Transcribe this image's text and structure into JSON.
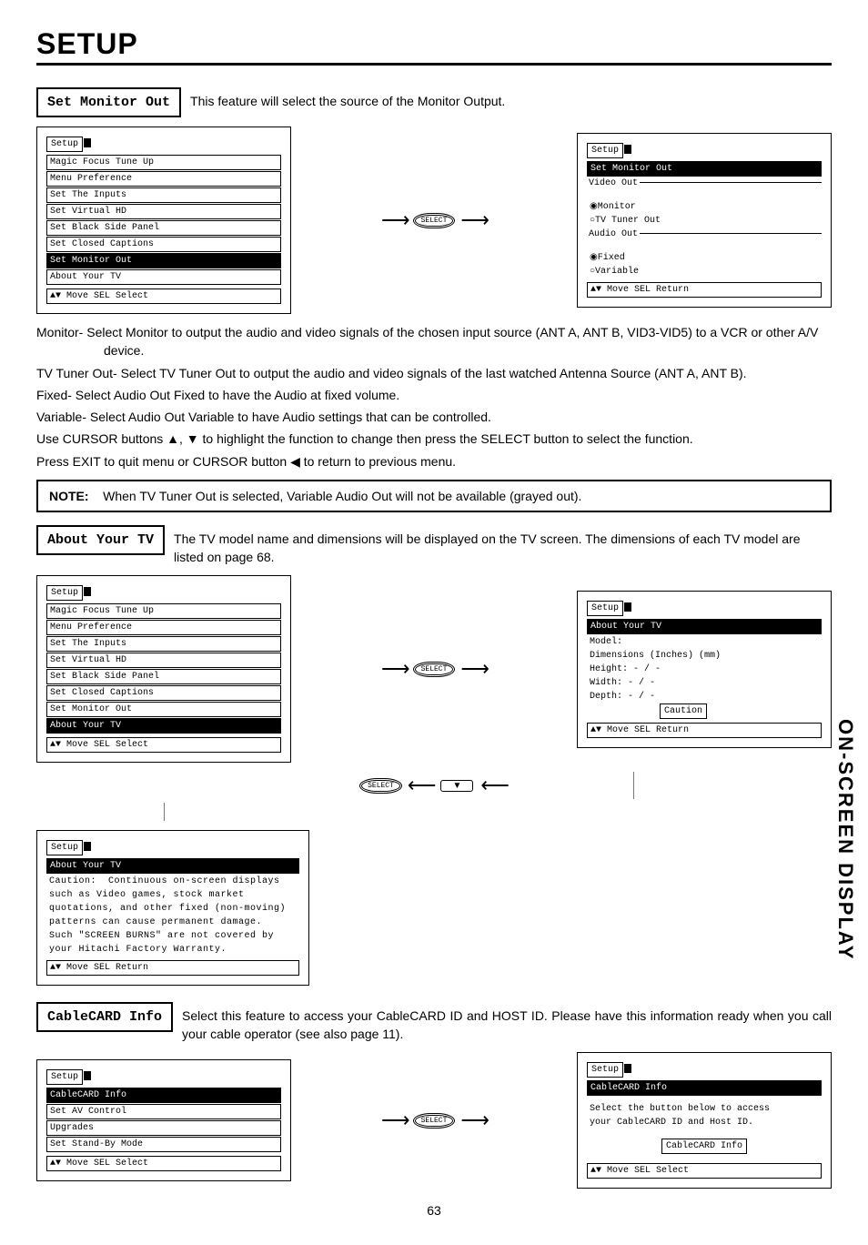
{
  "page": {
    "title": "Setup",
    "number": "63",
    "sidebar": "ON-SCREEN DISPLAY"
  },
  "setMonitorOut": {
    "label": "Set Monitor Out",
    "desc": "This feature will select the source of the Monitor Output.",
    "menuLeft": {
      "title": "Setup",
      "items": [
        "Magic Focus Tune Up",
        "Menu Preference",
        "Set The Inputs",
        "Set Virtual HD",
        "Set Black Side Panel",
        "Set Closed Captions",
        "Set Monitor Out",
        "About Your TV"
      ],
      "highlighted": "Set Monitor Out",
      "footer": "▲▼ Move  SEL Select"
    },
    "menuRight": {
      "title": "Setup",
      "header": "Set Monitor Out",
      "videoOut": {
        "label": "Video Out",
        "opts": [
          "Monitor",
          "TV Tuner Out"
        ],
        "sel": 0
      },
      "audioOut": {
        "label": "Audio Out",
        "opts": [
          "Fixed",
          "Variable"
        ],
        "sel": 0
      },
      "footer": "▲▼ Move  SEL Return"
    },
    "explain": {
      "monitor": "Monitor- Select Monitor to output the audio and video signals of the chosen input source (ANT A, ANT B, VID3-VID5) to a VCR or other A/V device.",
      "tuner": "TV Tuner Out- Select TV Tuner Out to output the audio and video signals of the last watched Antenna Source (ANT A, ANT B).",
      "fixed": "Fixed-  Select Audio Out Fixed to have the Audio at fixed volume.",
      "variable": "Variable- Select Audio Out Variable to have Audio settings that can be controlled.",
      "cursor": "Use CURSOR buttons ▲, ▼ to highlight the function to change then press the SELECT button to select the function.",
      "exit": "Press EXIT to quit menu or CURSOR button ◀ to return to previous menu."
    },
    "note": {
      "label": "NOTE:",
      "text": "When TV Tuner Out is selected, Variable Audio Out will not be available (grayed out)."
    }
  },
  "aboutYourTV": {
    "label": "About Your TV",
    "desc": "The TV model name and dimensions will be displayed on the TV screen.  The dimensions of each TV model are listed on page 68.",
    "menuLeft": {
      "title": "Setup",
      "items": [
        "Magic Focus Tune Up",
        "Menu Preference",
        "Set The Inputs",
        "Set Virtual HD",
        "Set Black Side Panel",
        "Set Closed Captions",
        "Set Monitor Out",
        "About Your TV"
      ],
      "highlighted": "About Your TV",
      "footer": "▲▼ Move  SEL Select"
    },
    "menuRight": {
      "title": "Setup",
      "header": "About Your TV",
      "model": "Model:",
      "dims": "Dimensions  (Inches) (mm)",
      "h": "Height:       - / -",
      "w": "Width:        - / -",
      "d": "Depth:        - / -",
      "caution": "Caution",
      "footer": "▲▼ Move  SEL Return"
    },
    "cautionBox": {
      "title": "Setup",
      "header": "About Your TV",
      "body": "Caution:  Continuous on-screen displays such as Video games, stock market quotations, and other fixed (non-moving) patterns can cause permanent damage.\nSuch \"SCREEN BURNS\" are not covered by your Hitachi Factory Warranty.",
      "footer": "▲▼ Move  SEL Return"
    }
  },
  "cableCard": {
    "label": "CableCARD Info",
    "desc": "Select this feature to access your CableCARD ID and HOST ID.  Please have this information ready when you call your cable operator (see also page 11).",
    "menuLeft": {
      "title": "Setup",
      "items": [
        "CableCARD Info",
        "Set AV Control",
        "Upgrades",
        "Set Stand-By Mode"
      ],
      "highlighted": "CableCARD Info",
      "footer": "▲▼ Move  SEL Select"
    },
    "menuRight": {
      "title": "Setup",
      "header": "CableCARD Info",
      "body1": "Select the button below to access",
      "body2": "your CableCARD ID and Host ID.",
      "button": "CableCARD Info",
      "footer": "▲▼ Move  SEL Select"
    }
  },
  "buttons": {
    "select": "SELECT",
    "down": "▼"
  }
}
